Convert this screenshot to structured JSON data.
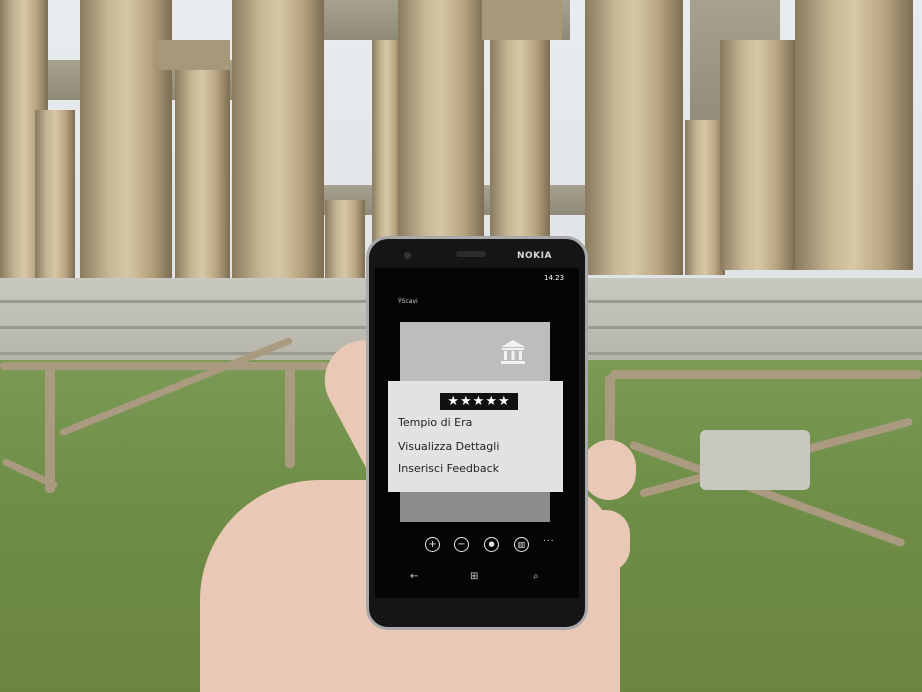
{
  "phone": {
    "brand": "NOKIA",
    "status_time": "14.23",
    "app_name": "ŸScavi"
  },
  "rating": {
    "stars_text": "★★★★★",
    "value": 4.5,
    "max": 5
  },
  "context_menu": {
    "items": [
      {
        "label": "Tempio di Era"
      },
      {
        "label": "Visualizza Dettagli"
      },
      {
        "label": "Inserisci Feedback"
      }
    ]
  },
  "app_bar": {
    "buttons": [
      {
        "icon": "add-icon",
        "glyph": "+"
      },
      {
        "icon": "remove-icon",
        "glyph": "−"
      },
      {
        "icon": "record-icon",
        "glyph": "●"
      },
      {
        "icon": "temple-icon",
        "glyph": "▥"
      }
    ],
    "more": "..."
  },
  "nav_keys": {
    "back": "←",
    "start": "⊞",
    "search": "⌕"
  },
  "colors": {
    "screen_bg": "#050505",
    "tile_bg": "#8c8c8c",
    "menu_bg": "#e2e2e2"
  }
}
